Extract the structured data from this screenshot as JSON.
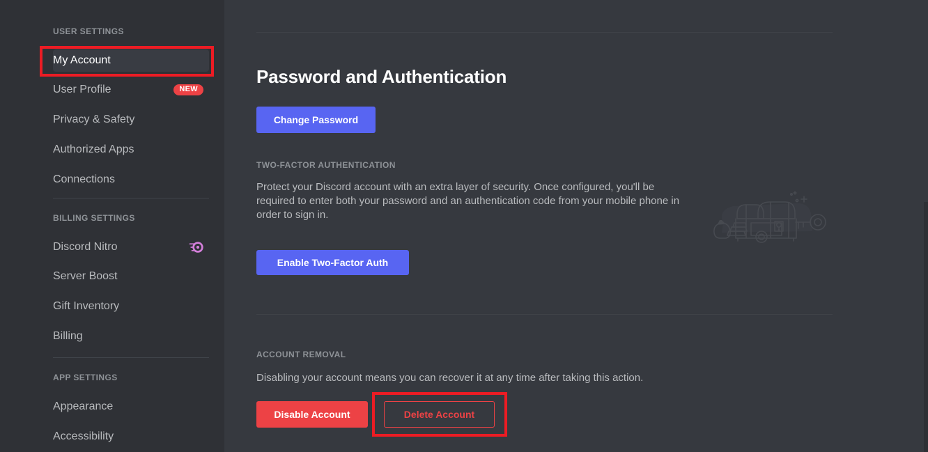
{
  "sidebar": {
    "sections": [
      {
        "header": "USER SETTINGS",
        "items": [
          {
            "label": "My Account",
            "selected": true,
            "badge": null,
            "icon": null
          },
          {
            "label": "User Profile",
            "selected": false,
            "badge": "NEW",
            "icon": null
          },
          {
            "label": "Privacy & Safety",
            "selected": false,
            "badge": null,
            "icon": null
          },
          {
            "label": "Authorized Apps",
            "selected": false,
            "badge": null,
            "icon": null
          },
          {
            "label": "Connections",
            "selected": false,
            "badge": null,
            "icon": null
          }
        ]
      },
      {
        "header": "BILLING SETTINGS",
        "items": [
          {
            "label": "Discord Nitro",
            "selected": false,
            "badge": null,
            "icon": "nitro-boost-icon"
          },
          {
            "label": "Server Boost",
            "selected": false,
            "badge": null,
            "icon": null
          },
          {
            "label": "Gift Inventory",
            "selected": false,
            "badge": null,
            "icon": null
          },
          {
            "label": "Billing",
            "selected": false,
            "badge": null,
            "icon": null
          }
        ]
      },
      {
        "header": "APP SETTINGS",
        "items": [
          {
            "label": "Appearance",
            "selected": false,
            "badge": null,
            "icon": null
          },
          {
            "label": "Accessibility",
            "selected": false,
            "badge": null,
            "icon": null
          }
        ]
      }
    ]
  },
  "main": {
    "page_title": "Password and Authentication",
    "change_password_label": "Change Password",
    "two_factor": {
      "label": "TWO-FACTOR AUTHENTICATION",
      "description": "Protect your Discord account with an extra layer of security. Once configured, you'll be required to enter both your password and an authentication code from your mobile phone in order to sign in.",
      "enable_label": "Enable Two-Factor Auth",
      "illustration": "treasure-chest-and-key-illustration"
    },
    "account_removal": {
      "label": "ACCOUNT REMOVAL",
      "description": "Disabling your account means you can recover it at any time after taking this action.",
      "disable_label": "Disable Account",
      "delete_label": "Delete Account"
    }
  },
  "annotations": {
    "color": "#EC1C24",
    "boxes": [
      {
        "target": "My Account"
      },
      {
        "target": "Delete Account"
      }
    ]
  },
  "colors": {
    "sidebar_bg": "#2F3136",
    "content_bg": "#36393F",
    "blurple": "#5865F2",
    "danger_red": "#ED4245",
    "nitro_pink": "#D47FDB",
    "text_muted": "#B9BBBE",
    "text_header": "#8E9297",
    "annotation_red": "#EC1C24"
  }
}
